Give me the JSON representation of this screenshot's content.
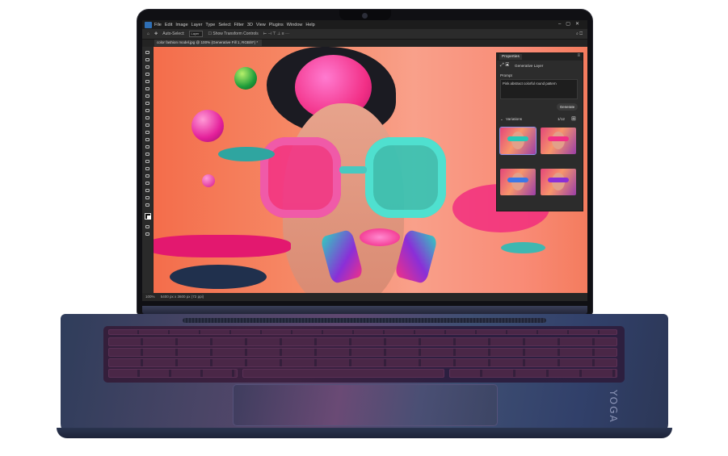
{
  "menubar": {
    "items": [
      "File",
      "Edit",
      "Image",
      "Layer",
      "Type",
      "Select",
      "Filter",
      "3D",
      "View",
      "Plugins",
      "Window",
      "Help"
    ]
  },
  "options_bar": {
    "auto_select_label": "Auto-Select:",
    "auto_select_value": "Layer",
    "show_transform_label": "Show Transform Controls"
  },
  "document": {
    "tab_title": "color fashion model.jpg @ 100% (Generative Fill 1, RGB/8*) *",
    "zoom": "100%",
    "status_info": "5400 px x 3600 px (72 ppi)"
  },
  "properties_panel": {
    "tab_label": "Properties",
    "layer_type": "Generative Layer",
    "prompt_heading": "Prompt",
    "prompt_text": "Pink abstract colorful round pattern",
    "generate_label": "Generate",
    "variations_label": "Variations",
    "variations_count": "1/12"
  },
  "colors": {
    "canvas_bg": "#f68a67",
    "ps_blue": "#2f6fb5",
    "glasses_teal": "#26c7b7",
    "glasses_pink": "#f22f86",
    "laptop_blue": "#31406a"
  },
  "device": {
    "brand_mark": "YOGA"
  }
}
